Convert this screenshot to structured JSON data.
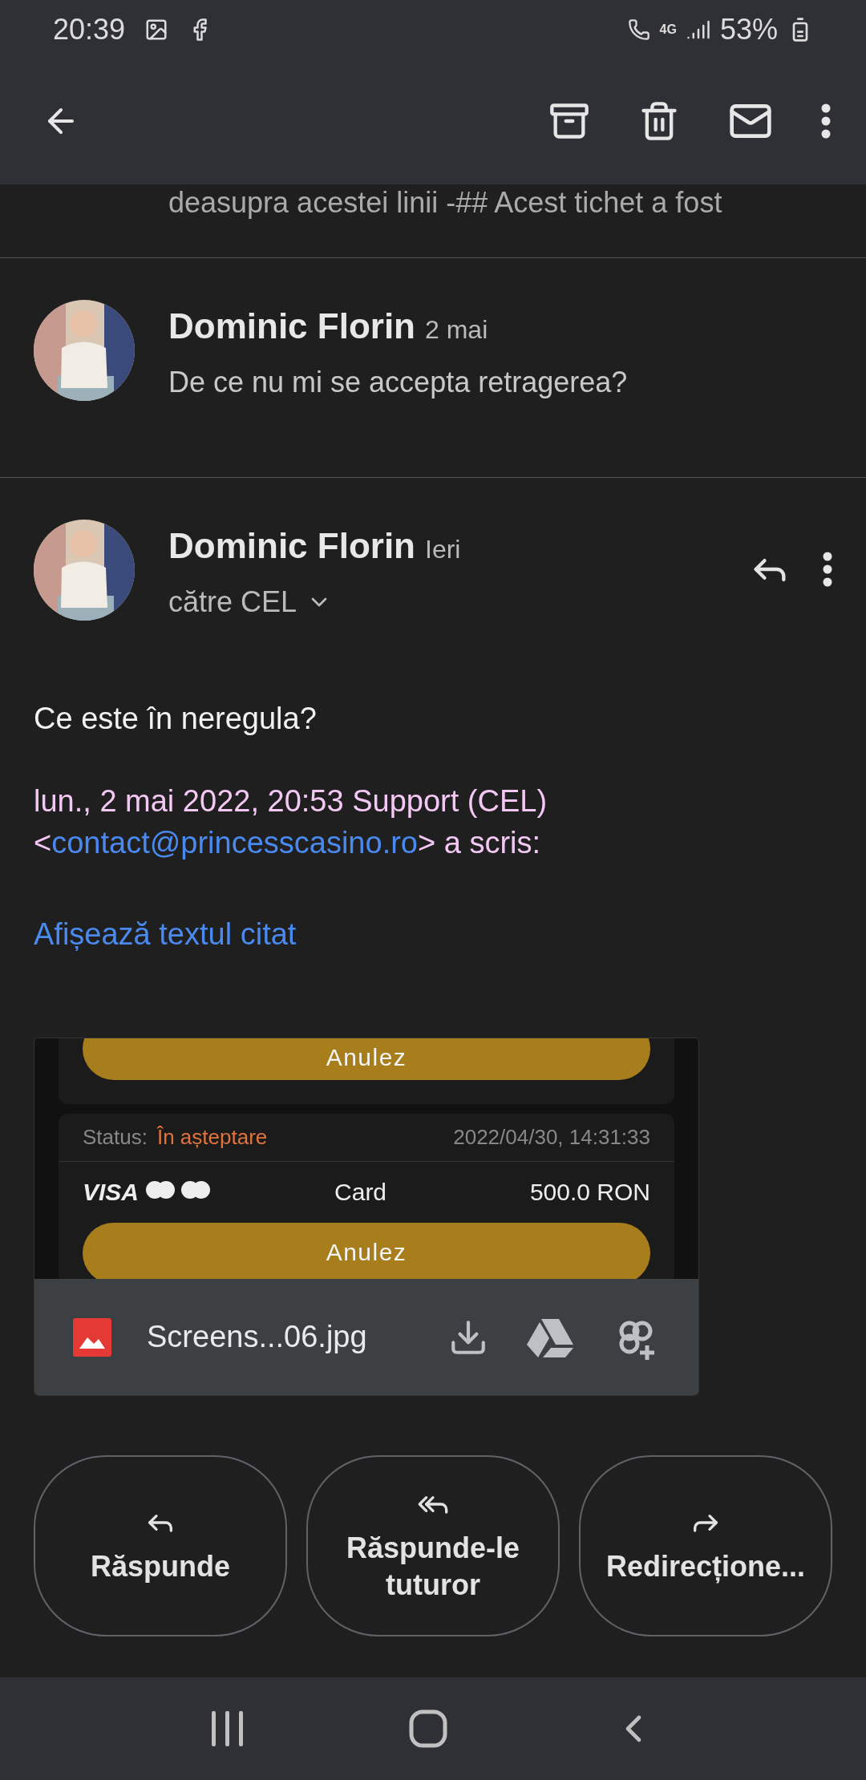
{
  "status_bar": {
    "time": "20:39",
    "battery": "53%",
    "network": "4G"
  },
  "snippet": "deasupra acestei linii -## Acest tichet a fost",
  "messages": [
    {
      "sender": "Dominic Florin",
      "date": "2 mai",
      "preview": "De ce nu mi se accepta retragerea?",
      "expanded": false
    },
    {
      "sender": "Dominic Florin",
      "date": "Ieri",
      "recipient": "către CEL",
      "expanded": true
    }
  ],
  "body": {
    "text": "Ce este în neregula?",
    "quote_header": "lun., 2 mai 2022, 20:53 Support (CEL)",
    "quote_open": "<",
    "email": "contact@princesscasino.ro",
    "quote_close": "> a scris:",
    "show_quoted": "Afișează textul citat"
  },
  "attachment": {
    "preview": {
      "top_button": "Anulez",
      "status_label": "Status:",
      "status_value": "În așteptare",
      "timestamp": "2022/04/30, 14:31:33",
      "card_brand": "VISA",
      "method": "Card",
      "amount": "500.0 RON",
      "button": "Anulez"
    },
    "file_name": "Screens...06.jpg"
  },
  "actions": [
    {
      "kind": "reply",
      "label": "Răspunde"
    },
    {
      "kind": "reply_all",
      "label": "Răspunde-le tuturor"
    },
    {
      "kind": "forward",
      "label": "Redirecțione..."
    }
  ]
}
